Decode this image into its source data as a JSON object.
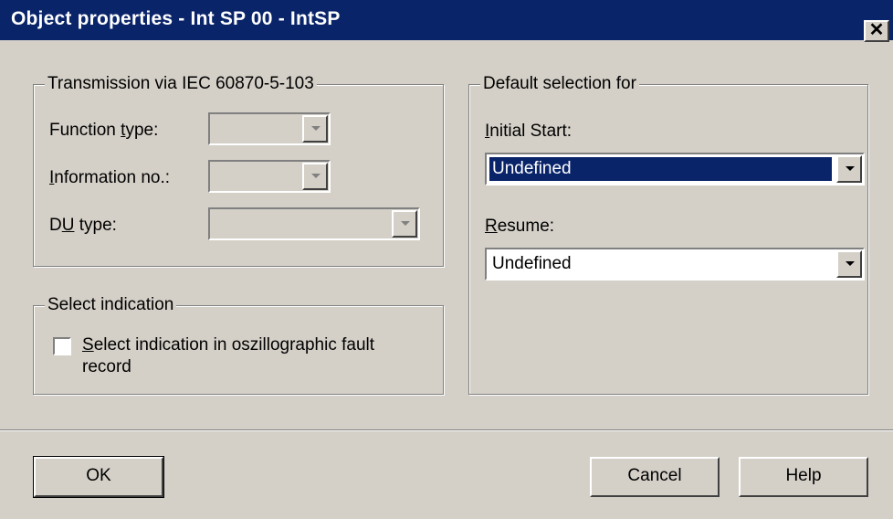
{
  "window": {
    "title": "Object properties - Int SP 00 - IntSP",
    "close_glyph": "✕"
  },
  "transmission": {
    "legend": "Transmission via IEC 60870-5-103",
    "function_type": {
      "label_pre": "Function ",
      "label_ul": "t",
      "label_post": "ype:",
      "value": ""
    },
    "information_no": {
      "label_pre": "",
      "label_ul": "I",
      "label_post": "nformation no.:",
      "value": ""
    },
    "du_type": {
      "label_pre": "D",
      "label_ul": "U",
      "label_post": " type:",
      "value": ""
    }
  },
  "select_indication": {
    "legend": "Select indication",
    "checkbox_label_ul": "S",
    "checkbox_label_line1": "elect indication in oszillographic fault",
    "checkbox_label_line2": "record",
    "checked": false
  },
  "default_selection": {
    "legend": "Default selection for",
    "initial_start": {
      "label_ul": "I",
      "label_rest": "nitial Start:",
      "value": "Undefined"
    },
    "resume": {
      "label_ul": "R",
      "label_rest": "esume:",
      "value": "Undefined"
    }
  },
  "buttons": {
    "ok": "OK",
    "cancel": "Cancel",
    "help": "Help"
  },
  "colors": {
    "titlebar": "#0a246a",
    "face": "#d4d0c8",
    "selection": "#0a246a"
  }
}
